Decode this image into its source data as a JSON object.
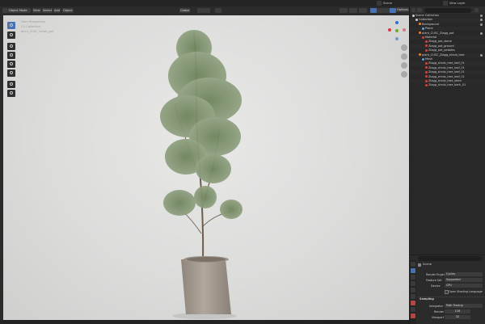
{
  "topbar": {
    "scene_label": "Scene",
    "view_layer_label": "View Layer"
  },
  "header": {
    "mode": "Object Mode",
    "menus": [
      "View",
      "Select",
      "Add",
      "Object"
    ],
    "transform": "Global",
    "options": "Options"
  },
  "viewport": {
    "overlay_lines": [
      "User Perspective",
      "(1) Collection",
      "birch_CUSC_ticket_pot"
    ]
  },
  "outliner": {
    "search_placeholder": "",
    "items": [
      {
        "label": "Scene Collection",
        "depth": 0,
        "icon": "collection-icon"
      },
      {
        "label": "Collection",
        "depth": 1,
        "icon": "collection-icon"
      },
      {
        "label": "Background",
        "depth": 2,
        "icon": "object-icon"
      },
      {
        "label": "Plane",
        "depth": 3,
        "icon": "mesh-icon"
      },
      {
        "label": "plant_CUSC_Ziagg_pot",
        "depth": 2,
        "icon": "object-icon"
      },
      {
        "label": "Material",
        "depth": 3,
        "icon": "material-icon"
      },
      {
        "label": "Ziagg_pot_stone",
        "depth": 4,
        "icon": "material-icon"
      },
      {
        "label": "Ziagg_pot_ground",
        "depth": 4,
        "icon": "material-icon"
      },
      {
        "label": "Ziagg_pot_pebbles",
        "depth": 4,
        "icon": "material-icon"
      },
      {
        "label": "plant_CUSC_Ziagg_shrub_tree",
        "depth": 2,
        "icon": "object-icon"
      },
      {
        "label": "Mesh",
        "depth": 3,
        "icon": "mesh-icon"
      },
      {
        "label": "Ziagg_shrub_tree_leaf_01",
        "depth": 4,
        "icon": "material-icon"
      },
      {
        "label": "Ziagg_shrub_tree_leaf_01",
        "depth": 4,
        "icon": "material-icon"
      },
      {
        "label": "Ziagg_shrub_tree_leaf_01",
        "depth": 4,
        "icon": "material-icon"
      },
      {
        "label": "Ziagg_shrub_tree_leaf_01",
        "depth": 4,
        "icon": "material-icon"
      },
      {
        "label": "Ziagg_shrub_tree_stem",
        "depth": 4,
        "icon": "material-icon"
      },
      {
        "label": "Ziagg_shrub_tree_bark_01",
        "depth": 4,
        "icon": "material-icon"
      }
    ]
  },
  "properties": {
    "header": "Scene",
    "rows": [
      {
        "label": "Render Engine",
        "value": "Cycles"
      },
      {
        "label": "Feature Set",
        "value": "Supported"
      },
      {
        "label": "Device",
        "value": "CPU"
      }
    ],
    "checkbox_label": "Open Shading Language",
    "section": "Sampling",
    "integrator_label": "Integrator",
    "integrator_value": "Path Tracing",
    "render_label": "Render",
    "render_value": "128",
    "viewport_label": "Viewport",
    "viewport_value": "32"
  },
  "colors": {
    "accent": "#4772b3",
    "panel": "#2b2b2b",
    "viewport_bg": "#dcdcdb",
    "leaf": "#7b8f68",
    "pot": "#a59c92"
  }
}
